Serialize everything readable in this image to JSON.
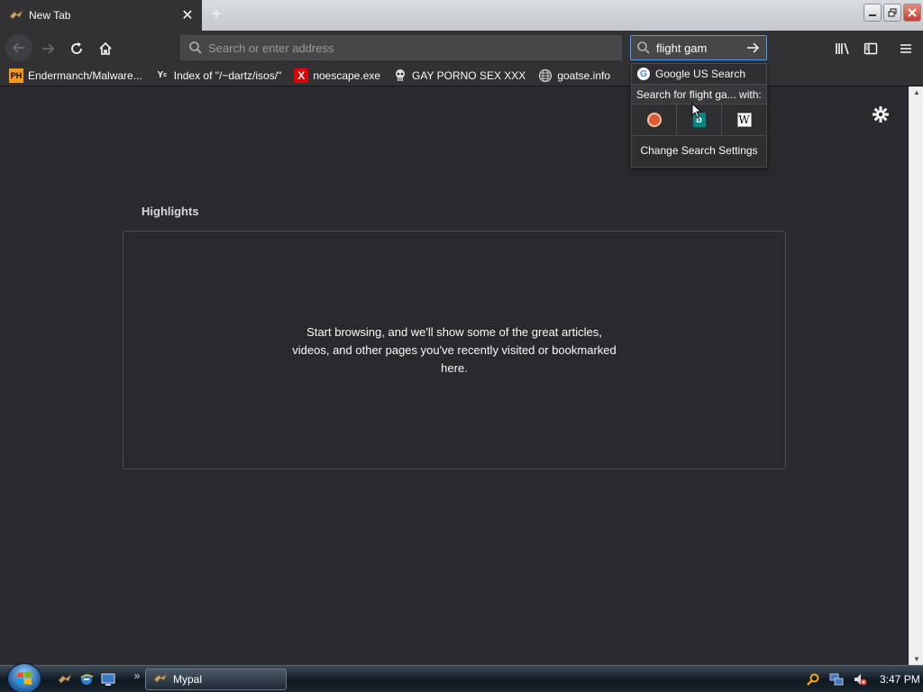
{
  "browser": {
    "tab": {
      "title": "New Tab",
      "close_glyph": "✕"
    },
    "new_tab_glyph": "+",
    "urlbar": {
      "placeholder": "Search or enter address"
    },
    "searchbar": {
      "value": "flight gam"
    }
  },
  "bookmarks": [
    {
      "label": "Endermanch/Malware...",
      "icon": "PH"
    },
    {
      "label": "Index of \"/~dartz/isos/\"",
      "icon": "Y"
    },
    {
      "label": "noescape.exe",
      "icon": "X"
    },
    {
      "label": "GAY PORNO SEX XXX",
      "icon": "bookmark-skull-icon"
    },
    {
      "label": "goatse.info",
      "icon": "globe-icon"
    }
  ],
  "search_popup": {
    "engine_label": "Google US Search",
    "search_for_label": "Search for flight ga... with:",
    "change_settings_label": "Change Search Settings",
    "engines": [
      "duckduckgo-icon",
      "bing-icon",
      "wikipedia-icon"
    ],
    "bing_glyph": "b",
    "wiki_glyph": "W",
    "google_glyph": "G"
  },
  "newtab": {
    "highlights_title": "Highlights",
    "highlights_message": "Start browsing, and we'll show some of the great articles, videos, and other pages you've recently visited or bookmarked here."
  },
  "taskbar": {
    "task_label": "Mypal",
    "more_glyph": "»",
    "clock": "3:47 PM"
  },
  "colors": {
    "chrome": "#323234",
    "content_bg": "#2a2a2e",
    "accent": "#45a1ff"
  }
}
